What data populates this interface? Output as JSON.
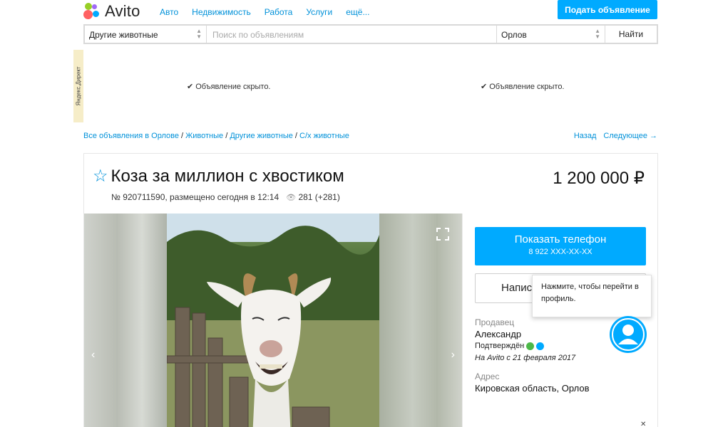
{
  "header": {
    "logo_text": "Avito",
    "nav": [
      "Авто",
      "Недвижимость",
      "Работа",
      "Услуги",
      "ещё..."
    ],
    "post_button": "Подать объявление"
  },
  "search": {
    "category": "Другие животные",
    "placeholder": "Поиск по объявлениям",
    "city": "Орлов",
    "find_button": "Найти"
  },
  "ads": {
    "direct_label": "Яндекс.Директ",
    "hidden_text": "Объявление скрыто."
  },
  "breadcrumbs": [
    "Все объявления в Орлове",
    "Животные",
    "Другие животные",
    "С/х животные"
  ],
  "pager": {
    "back": "Назад",
    "next": "Следующее →"
  },
  "listing": {
    "title": "Коза за миллион с хвостиком",
    "price": "1 200 000 ₽",
    "meta": "№ 920711590, размещено сегодня в 12:14",
    "views": "281 (+281)"
  },
  "contact": {
    "show_phone": "Показать телефон",
    "phone_masked": "8 922 XXX-XX-XX",
    "write_button": "Напис",
    "tooltip": "Нажмите, чтобы перейти в профиль.",
    "seller_label": "Продавец",
    "seller_name": "Александр",
    "verified": "Подтверждён",
    "since": "На Avito с 21 февраля 2017",
    "address_label": "Адрес",
    "address": "Кировская область, Орлов"
  },
  "colors": {
    "accent": "#00aaff",
    "link": "#0091d9"
  }
}
